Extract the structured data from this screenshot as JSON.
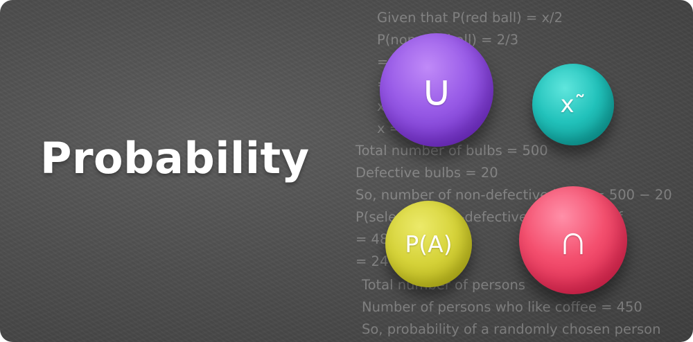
{
  "title": "Probability",
  "chalkboard_lines": [
    "Given that P(red ball) = x/2",
    "P(non-red ball) = 2/3",
    "=",
    "=",
    "x",
    "x =",
    "Total number of bulbs = 500",
    "Defective bulbs = 20",
    "So, number of non-defective bulbs = 500 − 20",
    "P(selecting non-defective) = number of",
    "= 480",
    "= 24",
    "Total number of persons",
    "Number of persons who like coffee = 450",
    "So, probability of a randomly chosen person"
  ],
  "symbols": {
    "union": "∪",
    "tilde": "x˜",
    "probability": "P(A)",
    "intersection": "∩"
  },
  "colors": {
    "background": "#4f4f4f",
    "union_ball": "#8a4de0",
    "tilde_ball": "#1fb8b1",
    "probability_ball": "#d3cf35",
    "intersection_ball": "#ef4466"
  }
}
